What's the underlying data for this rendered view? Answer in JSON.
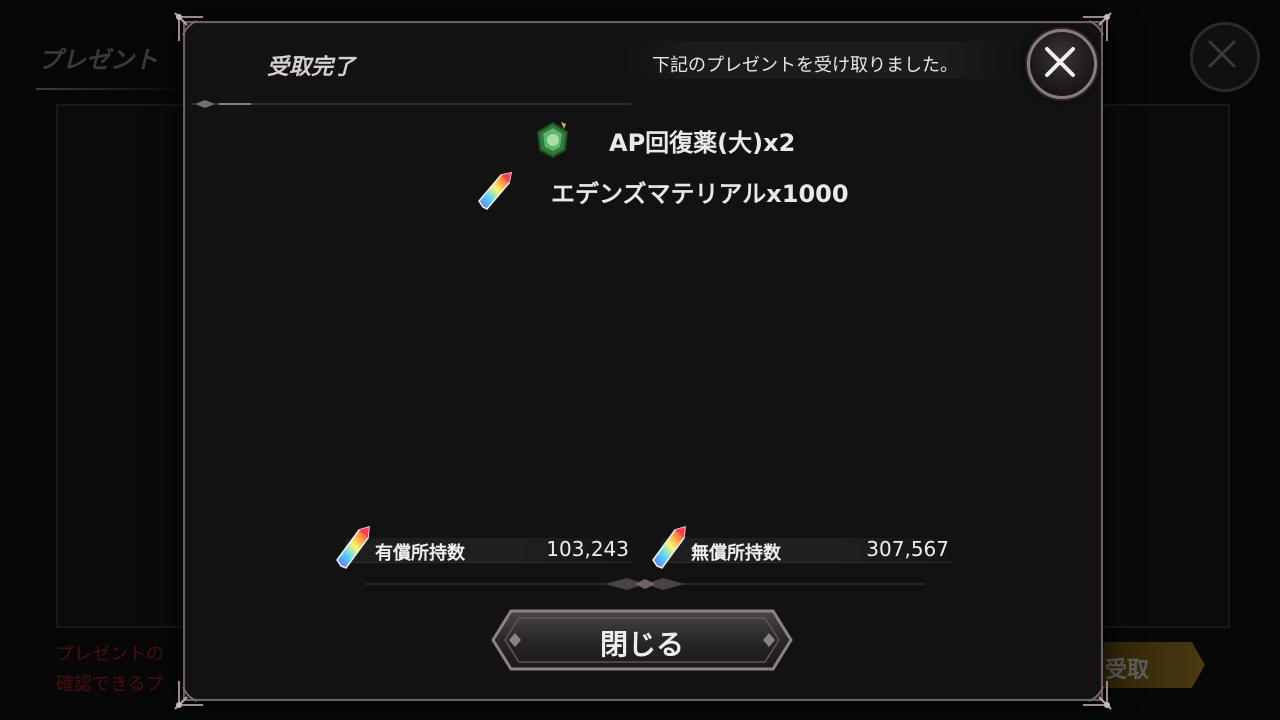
{
  "background": {
    "title": "プレゼント",
    "notice_line1": "プレゼントの",
    "notice_line2": "確認できるプ",
    "receive_button_label": "受取"
  },
  "modal": {
    "title": "受取完了",
    "message": "下記のプレゼントを受け取りました。",
    "close_icon": "close-x-icon",
    "items": [
      {
        "icon": "green-potion-icon",
        "label": "AP回復薬(大)x2"
      },
      {
        "icon": "rainbow-crystal-icon",
        "label": "エデンズマテリアルx1000"
      }
    ],
    "balances": {
      "paid": {
        "icon": "rainbow-crystal-icon",
        "label": "有償所持数",
        "value": "103,243"
      },
      "free": {
        "icon": "rainbow-crystal-icon",
        "label": "無償所持数",
        "value": "307,567"
      }
    },
    "confirm_button_label": "閉じる"
  },
  "colors": {
    "frame": "#6d5f5f",
    "modal_bg": "#121212",
    "text": "#ece8e8",
    "notice_red": "#4a0f0f",
    "receive_gold": "#4a3910"
  }
}
